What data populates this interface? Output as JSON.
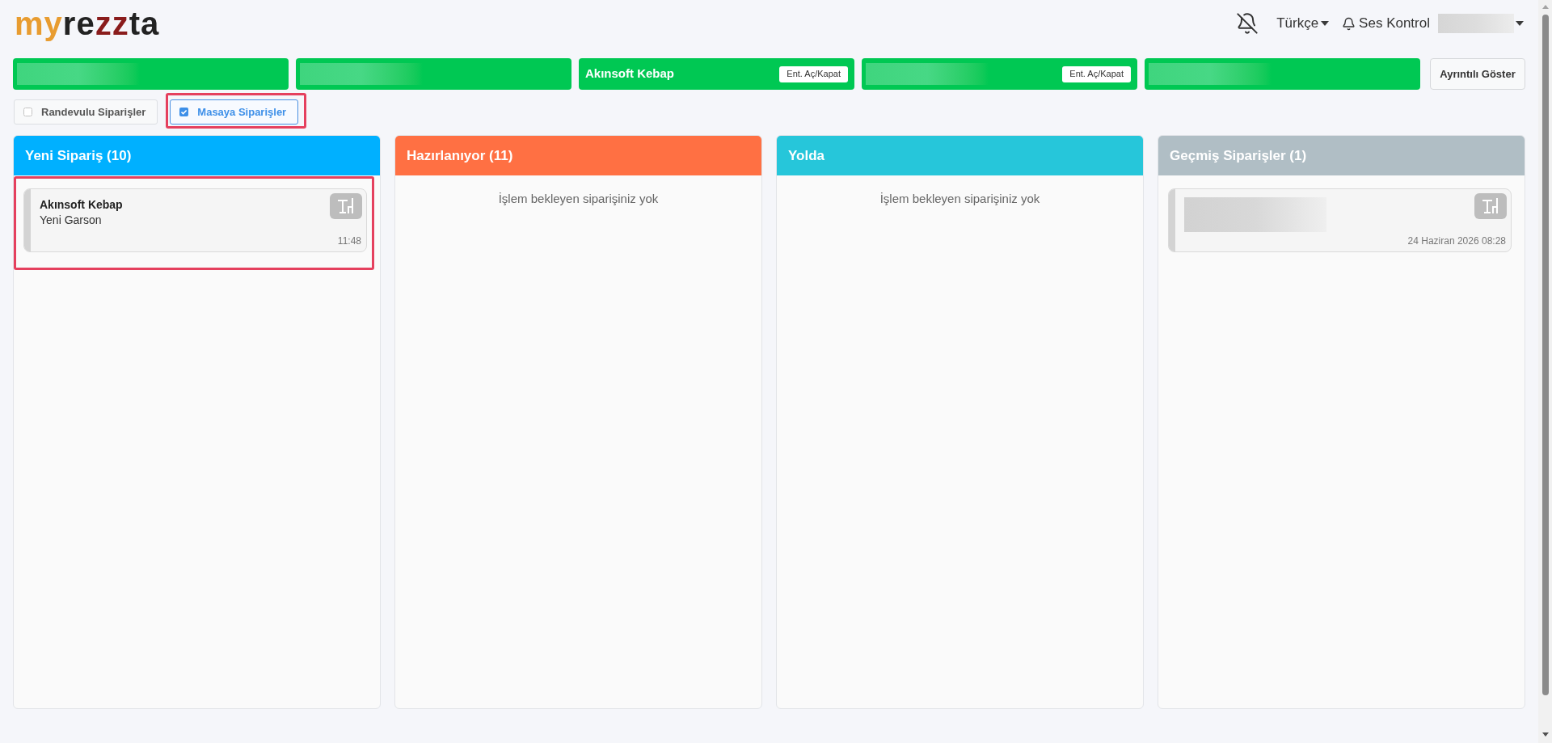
{
  "logo": [
    {
      "text": "my",
      "color": "#e89c30"
    },
    {
      "text": "re",
      "color": "#222222"
    },
    {
      "text": "zz",
      "color": "#8a1c1c"
    },
    {
      "text": "ta",
      "color": "#222222"
    }
  ],
  "header": {
    "notifications_muted": true,
    "language": "Türkçe",
    "sound_control": "Ses Kontrol",
    "user_name_hidden": true
  },
  "stores": [
    {
      "name_hidden": true
    },
    {
      "name_hidden": true
    },
    {
      "name_hidden": false,
      "name": "Akınsoft Kebap",
      "toggle_button": "Ent. Aç/Kapat"
    },
    {
      "name_hidden": true,
      "toggle_button": "Ent. Aç/Kapat"
    },
    {
      "name_hidden": true
    }
  ],
  "details_button": "Ayrıntılı Göster",
  "filters": [
    {
      "label": "Randevulu Siparişler",
      "checked": false,
      "highlighted": false
    },
    {
      "label": "Masaya Siparişler",
      "checked": true,
      "highlighted": true
    }
  ],
  "columns": [
    {
      "title": "Yeni Sipariş (10)",
      "color": "#00b0ff",
      "orders": [
        {
          "details_hidden": false,
          "title": "Akınsoft Kebap",
          "subtitle": "Yeni Garson",
          "time": "11:48",
          "highlighted": true
        }
      ]
    },
    {
      "title": "Hazırlanıyor (11)",
      "color": "#ff7043",
      "empty_text": "İşlem bekleyen siparişiniz yok"
    },
    {
      "title": "Yolda",
      "color": "#26c6da",
      "empty_text": "İşlem bekleyen siparişiniz yok"
    },
    {
      "title": "Geçmiş Siparişler (1)",
      "color": "#b0bec5",
      "orders": [
        {
          "details_hidden": true,
          "time": "24 Haziran 2026 08:28",
          "highlighted": false
        }
      ]
    }
  ]
}
